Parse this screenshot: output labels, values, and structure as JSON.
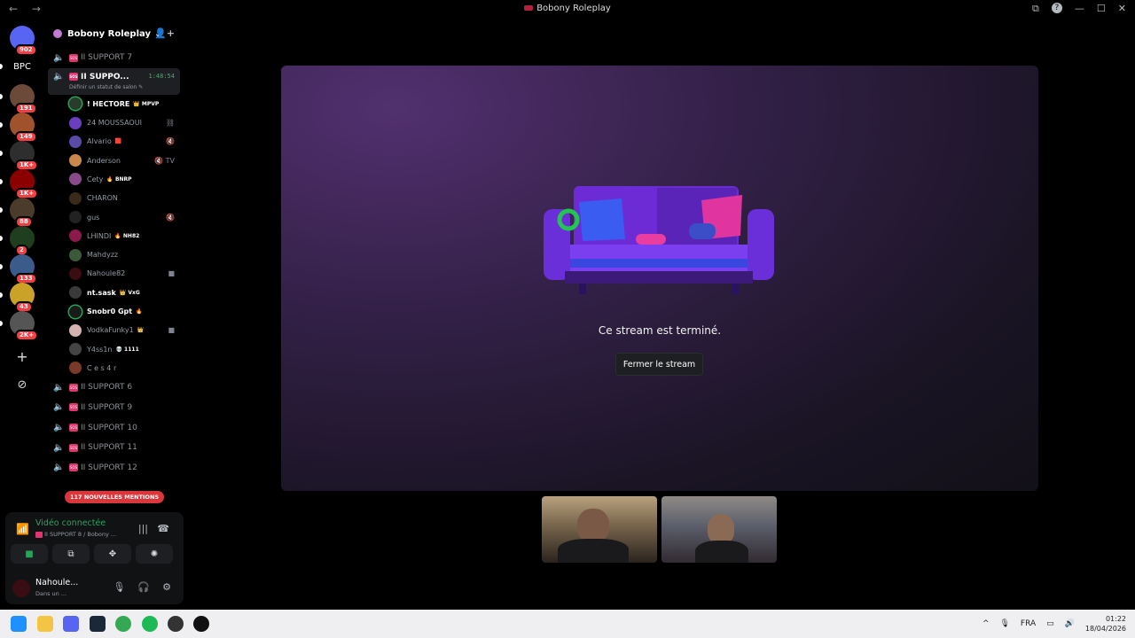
{
  "window": {
    "title": "Bobony Roleplay",
    "nav": "← →",
    "tools": [
      "⧉",
      "?",
      "—",
      "☐",
      "✕"
    ]
  },
  "guilds": [
    {
      "name": "discord-home",
      "badge": "902",
      "color": "#5865f2"
    },
    {
      "name": "bpc",
      "text": "BPC",
      "color": "#000000"
    },
    {
      "name": "guild-1",
      "badge": "191",
      "color": "#6b4a3a"
    },
    {
      "name": "guild-2",
      "badge": "149",
      "color": "#a0522d"
    },
    {
      "name": "guild-3",
      "badge": "1K+",
      "color": "#2e2e2e"
    },
    {
      "name": "guild-4",
      "badge": "1K+",
      "color": "#8b0000"
    },
    {
      "name": "guild-5",
      "badge": "88",
      "color": "#4a3b2a"
    },
    {
      "name": "guild-6",
      "badge": "2",
      "color": "#1f3d1f"
    },
    {
      "name": "guild-7",
      "badge": "133",
      "color": "#3b5b8b"
    },
    {
      "name": "guild-8",
      "badge": "43",
      "color": "#c9a227"
    },
    {
      "name": "guild-9",
      "badge": "2K+",
      "color": "#555555"
    }
  ],
  "add_server": "+",
  "explore": "⊘",
  "server": {
    "name": "Bobony Roleplay",
    "chevron": "⌄",
    "invite": "👤+"
  },
  "channels_before": [
    {
      "name": "SUPPORT 7",
      "prefix": "II"
    }
  ],
  "active_channel": {
    "name": "SUPPO...",
    "prefix": "II",
    "timer": "1:48:54",
    "status": "Définir un statut de salon ✎"
  },
  "members": [
    {
      "name": "! HECTORE",
      "tag": "👑 MPVP",
      "live": true,
      "color": "#2b3b2b",
      "ring": "#23a55a"
    },
    {
      "name": "24 MOUSSAOUI",
      "tag": "",
      "live": false,
      "color": "#6a3fbf",
      "icon": "⛓"
    },
    {
      "name": "Alvario",
      "tag": "🟥",
      "live": false,
      "color": "#5a4aa8",
      "icon": "🔇"
    },
    {
      "name": "Anderson",
      "tag": "",
      "live": false,
      "color": "#c9874b",
      "icon": "🔇 TV"
    },
    {
      "name": "Cety",
      "tag": "🔥 BNRP",
      "live": false,
      "color": "#8a4a8a"
    },
    {
      "name": "CHARON",
      "tag": "",
      "live": false,
      "color": "#3a2a1a"
    },
    {
      "name": "gus",
      "tag": "",
      "live": false,
      "color": "#222222",
      "icon": "🔇"
    },
    {
      "name": "LHINDI",
      "tag": "🔥 NH82",
      "live": false,
      "color": "#8b1a4a"
    },
    {
      "name": "Mahdyzz",
      "tag": "",
      "live": false,
      "color": "#3a5a3a"
    },
    {
      "name": "Nahoule82",
      "tag": "",
      "live": false,
      "color": "#3a0d12",
      "icon": "■"
    },
    {
      "name": "nt.sask",
      "tag": "👑 VxG",
      "live": true,
      "color": "#3a3a3a"
    },
    {
      "name": "Snobr0 Gpt",
      "tag": "🔥",
      "live": true,
      "color": "#1a1a1a",
      "ring": "#23a55a"
    },
    {
      "name": "VodkaFunky1",
      "tag": "👑",
      "live": false,
      "color": "#d4b3b3",
      "icon": "■"
    },
    {
      "name": "Y4ss1n",
      "tag": "💀 1111",
      "live": false,
      "color": "#444444"
    },
    {
      "name": "C e s 4 r",
      "tag": "",
      "live": false,
      "color": "#7a3a2a"
    }
  ],
  "channels_after": [
    {
      "name": "SUPPORT 6",
      "prefix": "II"
    },
    {
      "name": "SUPPORT 9",
      "prefix": "II"
    },
    {
      "name": "SUPPORT 10",
      "prefix": "II"
    },
    {
      "name": "SUPPORT 11",
      "prefix": "II"
    },
    {
      "name": "SUPPORT 12",
      "prefix": "II"
    }
  ],
  "sos_label": "SOS",
  "mentions": "117 NOUVELLES MENTIONS",
  "voice": {
    "status": "Vidéo connectée",
    "location": "II SUPPORT 8 / Bobony ...",
    "noise_icon": "|||",
    "hangup_icon": "☎",
    "buttons": [
      {
        "name": "camera-button",
        "icon": "■"
      },
      {
        "name": "screen-share-button",
        "icon": "⧉"
      },
      {
        "name": "activities-button",
        "icon": "✥"
      },
      {
        "name": "soundboard-button",
        "icon": "✺"
      }
    ]
  },
  "user": {
    "name": "Nahoule...",
    "status": "Dans un ...",
    "mic": "🎙",
    "headset": "🎧",
    "settings": "⚙"
  },
  "stream": {
    "ended_text": "Ce stream est terminé.",
    "close_label": "Fermer le stream"
  },
  "taskbar": {
    "lang": "FRA",
    "time": "01:22",
    "date": "18/04/2026",
    "tray_up": "^",
    "apps": [
      {
        "name": "windows-start",
        "color": "#1e90ff"
      },
      {
        "name": "file-explorer",
        "color": "#f4c542"
      },
      {
        "name": "discord-app",
        "color": "#5865f2"
      },
      {
        "name": "steam-app",
        "color": "#1b2838"
      },
      {
        "name": "chrome-app",
        "color": "#34a853"
      },
      {
        "name": "spotify-app",
        "color": "#1db954"
      },
      {
        "name": "game-app",
        "color": "#333333"
      },
      {
        "name": "g-hub-app",
        "color": "#111111"
      }
    ]
  },
  "colors": {
    "accent_green": "#23a55a",
    "badge_red": "#f23f43",
    "sos_pink": "#e0356f"
  }
}
